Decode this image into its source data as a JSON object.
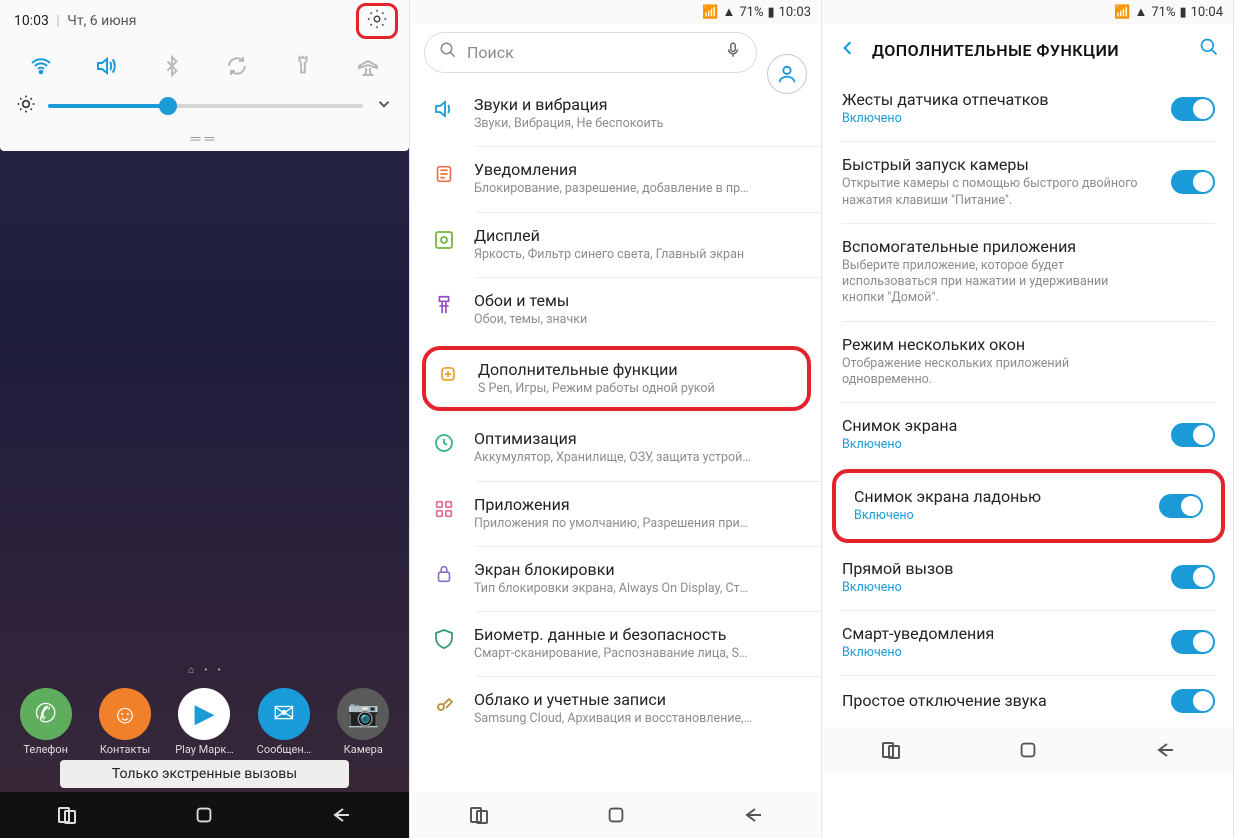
{
  "panel1": {
    "time": "10:03",
    "date": "Чт, 6 июня",
    "emergency_text": "Только экстренные вызовы",
    "dock": [
      {
        "label": "Телефон",
        "bg": "#5fae5e"
      },
      {
        "label": "Контакты",
        "bg": "#f0812a"
      },
      {
        "label": "Play Марк…",
        "bg": "#ffffff"
      },
      {
        "label": "Сообщен…",
        "bg": "#1b9cda"
      },
      {
        "label": "Камера",
        "bg": "#5a5a5a"
      }
    ]
  },
  "panel2": {
    "status": {
      "signal": "71%",
      "time": "10:03"
    },
    "search_placeholder": "Поиск",
    "items": [
      {
        "icon": "sound",
        "color": "#1a9bd8",
        "title": "Звуки и вибрация",
        "sub": "Звуки, Вибрация, Не беспокоить"
      },
      {
        "icon": "notif",
        "color": "#e67348",
        "title": "Уведомления",
        "sub": "Блокирование, разрешение, добавление в пр…"
      },
      {
        "icon": "display",
        "color": "#6fb544",
        "title": "Дисплей",
        "sub": "Яркость, Фильтр синего света, Главный экран"
      },
      {
        "icon": "themes",
        "color": "#9a4cc2",
        "title": "Обои и темы",
        "sub": "Обои, темы, значки"
      },
      {
        "icon": "adv",
        "color": "#e8a630",
        "title": "Дополнительные функции",
        "sub": "S Pen, Игры, Режим работы одной рукой",
        "highlight": true
      },
      {
        "icon": "opt",
        "color": "#36b28a",
        "title": "Оптимизация",
        "sub": "Аккумулятор, Хранилище, ОЗУ, защита устрой…"
      },
      {
        "icon": "apps",
        "color": "#e06a8a",
        "title": "Приложения",
        "sub": "Приложения по умолчанию, Разрешения при…"
      },
      {
        "icon": "lock",
        "color": "#8a6fc9",
        "title": "Экран блокировки",
        "sub": "Тип блокировки экрана, Always On Display, Ст…"
      },
      {
        "icon": "bio",
        "color": "#3a9b6f",
        "title": "Биометр. данные и безопасность",
        "sub": "Смарт-сканирование, Распознавание лица, S…"
      },
      {
        "icon": "cloud",
        "color": "#b8903a",
        "title": "Облако и учетные записи",
        "sub": "Samsung Cloud, Архивация и восстановление,…"
      }
    ]
  },
  "panel3": {
    "status": {
      "signal": "71%",
      "time": "10:04"
    },
    "title": "ДОПОЛНИТЕЛЬНЫЕ ФУНКЦИИ",
    "items": [
      {
        "title": "Жесты датчика отпечатков",
        "sub": "Включено",
        "sub_blue": true,
        "toggle": true
      },
      {
        "title": "Быстрый запуск камеры",
        "sub": "Открытие камеры с помощью быстрого двойного нажатия клавиши \"Питание\".",
        "toggle": true
      },
      {
        "title": "Вспомогательные приложения",
        "sub": "Выберите приложение, которое будет использоваться при нажатии и удерживании кнопки \"Домой\"."
      },
      {
        "title": "Режим нескольких окон",
        "sub": "Отображение нескольких приложений одновременно."
      },
      {
        "title": "Снимок экрана",
        "sub": "Включено",
        "sub_blue": true,
        "toggle": true
      },
      {
        "title": "Снимок экрана ладонью",
        "sub": "Включено",
        "sub_blue": true,
        "toggle": true,
        "highlight": true
      },
      {
        "title": "Прямой вызов",
        "sub": "Включено",
        "sub_blue": true,
        "toggle": true
      },
      {
        "title": "Смарт-уведомления",
        "sub": "Включено",
        "sub_blue": true,
        "toggle": true
      },
      {
        "title": "Простое отключение звука",
        "sub": "",
        "toggle": true
      }
    ]
  }
}
